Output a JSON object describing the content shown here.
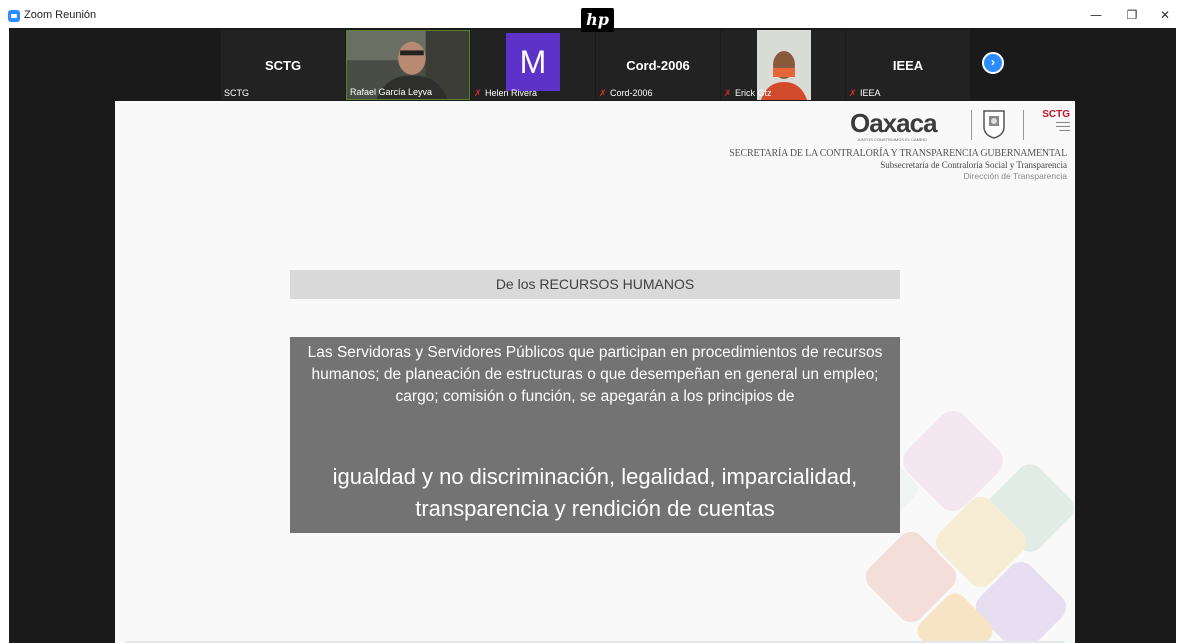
{
  "window": {
    "title": "Zoom Reunión",
    "minimize_glyph": "—",
    "restore_glyph": "❐",
    "close_glyph": "✕"
  },
  "overlay_logo": "hp",
  "participants": [
    {
      "big_name": "SCTG",
      "label": "SCTG",
      "muted": false,
      "video": false
    },
    {
      "big_name": "",
      "label": "Rafael García Leyva",
      "muted": false,
      "video": true
    },
    {
      "big_name": "",
      "avatar_letter": "M",
      "label": "Helen Rivera",
      "muted": true,
      "video": false
    },
    {
      "big_name": "Cord-2006",
      "label": "Cord-2006",
      "muted": true,
      "video": false
    },
    {
      "big_name": "",
      "label": "Erick Gtz",
      "muted": true,
      "video": true
    },
    {
      "big_name": "IEEA",
      "label": "IEEA",
      "muted": true,
      "video": false
    }
  ],
  "next_page_icon": "chevron-right-icon",
  "slide": {
    "logo_text": "Oaxaca",
    "logo_tagline": "JUNTOS CONSTRUIMOS EL CAMBIO",
    "sctg_logo": "SCTG",
    "header_line1": "SECRETARÍA DE LA CONTRALORÍA Y TRANSPARENCIA GUBERNAMENTAL",
    "header_line2": "Subsecretaría de Contraloría Social y Transparencia",
    "header_line3": "Dirección de Transparencia",
    "section_title": "De los RECURSOS HUMANOS",
    "body_text": "Las Servidoras y Servidores Públicos que participan en procedimientos de recursos humanos; de planeación de estructuras o que desempeñan en general un empleo; cargo; comisión o función, se apegarán a los principios de",
    "principles": "igualdad y no discriminación, legalidad, imparcialidad, transparencia y rendición de cuentas"
  },
  "colors": {
    "zoom_blue": "#2d8cff",
    "muted_red": "#e02828",
    "avatar_purple": "#5d32c8",
    "sctg_red": "#c2102a"
  }
}
